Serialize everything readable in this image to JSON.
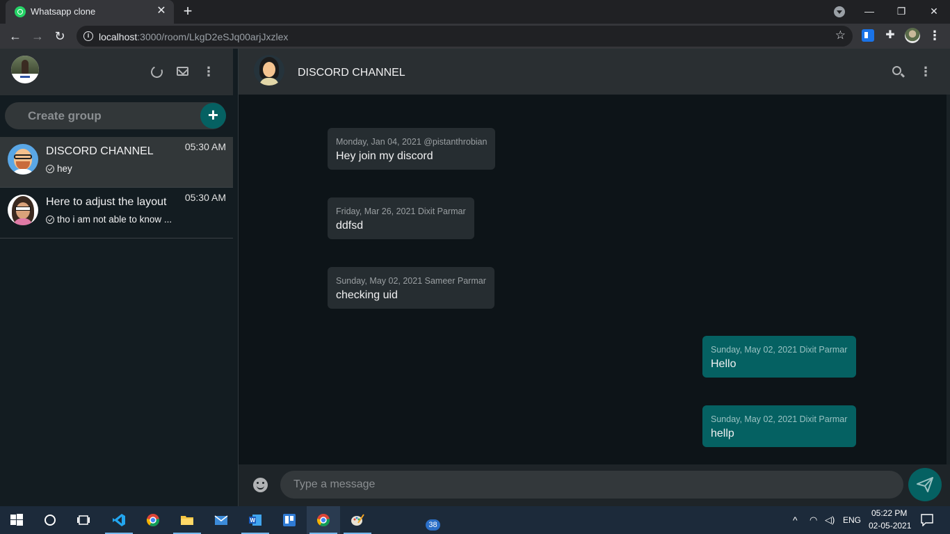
{
  "browser": {
    "tab_title": "Whatsapp clone",
    "url_host": "localhost",
    "url_rest": ":3000/room/LkgD2eSJq00arjJxzlex",
    "tab_close": "✕",
    "new_tab": "+",
    "win_min": "—",
    "win_max": "❐",
    "win_close": "✕"
  },
  "sidebar": {
    "search_placeholder": "Create group",
    "add_label": "+",
    "chats": [
      {
        "name": "DISCORD CHANNEL",
        "time": "05:30 AM",
        "last_message": "hey",
        "active": true
      },
      {
        "name": "Here to adjust the layout",
        "time": "05:30 AM",
        "last_message": "tho i am not able to know ...",
        "active": false
      }
    ]
  },
  "chat": {
    "room_name": "DISCORD CHANNEL",
    "messages": [
      {
        "direction": "in",
        "meta": "Monday, Jan 04, 2021 @pistanthrobian",
        "text": "Hey join my discord"
      },
      {
        "direction": "in",
        "meta": "Friday, Mar 26, 2021 Dixit Parmar",
        "text": "ddfsd"
      },
      {
        "direction": "in",
        "meta": "Sunday, May 02, 2021 Sameer Parmar",
        "text": "checking uid"
      },
      {
        "direction": "out",
        "meta": "Sunday, May 02, 2021 Dixit Parmar",
        "text": "Hello"
      },
      {
        "direction": "out",
        "meta": "Sunday, May 02, 2021 Dixit Parmar",
        "text": "hellp"
      }
    ],
    "input_placeholder": "Type a message"
  },
  "taskbar": {
    "mail_badge": "38",
    "language": "ENG",
    "time": "05:22 PM",
    "date": "02-05-2021"
  },
  "colors": {
    "accent": "#056162",
    "panel": "#2a2f32",
    "background": "#0d1418"
  }
}
